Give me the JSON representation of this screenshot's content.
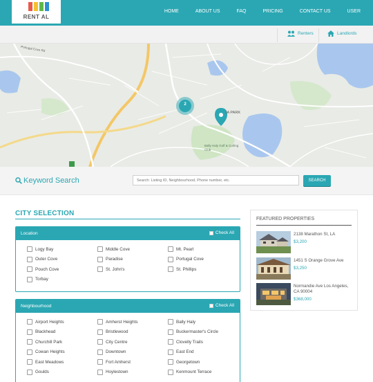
{
  "brand": {
    "logo_text": "RENT AL",
    "colors": [
      "#e85b4a",
      "#f2c230",
      "#5fb847",
      "#2c8fd1"
    ]
  },
  "nav": {
    "items": [
      "HOME",
      "ABOUT US",
      "FAQ",
      "PRICING",
      "CONTACT US",
      "USER"
    ]
  },
  "subnav": {
    "renters": "Renters",
    "landlords": "Landlords"
  },
  "map": {
    "cluster_count": "2",
    "label_park": "IA PARK",
    "label_golf": "Bally Haly Golf & Curling Club",
    "label_road": "Portugal Cove Rd"
  },
  "search": {
    "title": "Keyword Search",
    "placeholder": "Search: Listing ID, Neighbourhood, Phone number, etc.",
    "button": "SEARCH"
  },
  "city": {
    "title": "CITY SELECTION",
    "location": {
      "title": "Location",
      "check_all": "Check All",
      "items": [
        "Logy Bay",
        "Middle Cove",
        "Mt. Pearl",
        "Outer Cove",
        "Paradise",
        "Portugal Cove",
        "Pouch Cove",
        "St. John's",
        "St. Phillips",
        "Torbay"
      ]
    },
    "neighbourhood": {
      "title": "Neighbourhood",
      "check_all": "Check All",
      "items": [
        "Airport Heights",
        "Amherst Heights",
        "Bally Haly",
        "Blackhead",
        "Bristlewood",
        "Buckermaster's Circle",
        "Churchill Park",
        "City Centre",
        "Clovelly Trails",
        "Cowan Heights",
        "Downtown",
        "East End",
        "East Meadows",
        "Fort Amherst",
        "Georgetown",
        "Goulds",
        "Hoylestown",
        "Kenmount Terrace"
      ]
    }
  },
  "featured": {
    "title": "FEATURED PROPERTIES",
    "items": [
      {
        "address": "2138 Marathon St, LA",
        "price": "$3,200"
      },
      {
        "address": "1451 S Orange Grove Ave",
        "price": "$3,250"
      },
      {
        "address": "Normandie Ave Los Angeles, CA 90004",
        "price": "$368,000"
      }
    ]
  },
  "accent": "#2aa7b3"
}
